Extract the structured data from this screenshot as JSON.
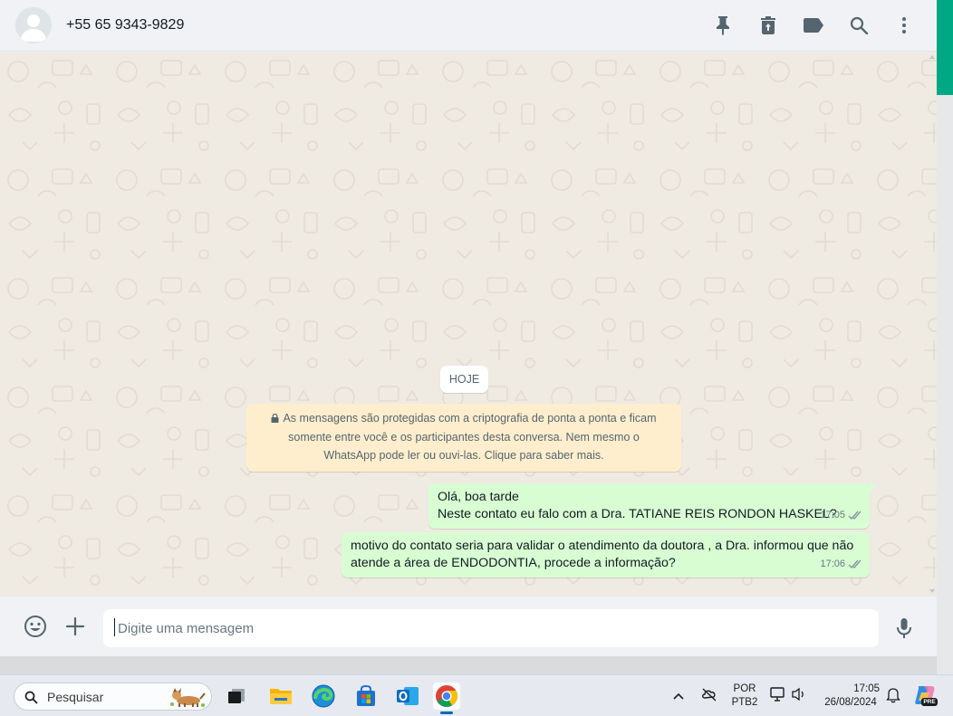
{
  "header": {
    "contact_name": "+55 65 9343-9829",
    "icons": [
      "pin-icon",
      "delete-icon",
      "label-icon",
      "search-icon",
      "menu-icon"
    ]
  },
  "chat": {
    "day_chip": "HOJE",
    "encryption_notice": "As mensagens são protegidas com a criptografia de ponta a ponta e ficam somente entre você e os participantes desta conversa. Nem mesmo o WhatsApp pode ler ou ouvi-las. Clique para saber mais.",
    "messages": [
      {
        "line1": "Olá, boa tarde",
        "line2": "Neste contato eu falo com a Dra. TATIANE REIS RONDON HASKEL?",
        "time": "17:05",
        "status": "delivered"
      },
      {
        "line1": "motivo do contato seria para validar o atendimento da doutora , a Dra. informou que não",
        "line2": "atende a área de ENDODONTIA, procede a informação?",
        "time": "17:06",
        "status": "delivered"
      }
    ]
  },
  "composer": {
    "placeholder": "Digite uma mensagem",
    "value": ""
  },
  "taskbar": {
    "search_placeholder": "Pesquisar",
    "language_top": "POR",
    "language_bottom": "PTB2",
    "time": "17:05",
    "date": "26/08/2024",
    "copilot_badge": "PRE"
  },
  "colors": {
    "accent": "#00a884",
    "outgoing_bubble": "#d9fdd3",
    "notice_bg": "#ffeecd",
    "chat_bg": "#efeae2",
    "read_ticks": "#8696a0"
  }
}
